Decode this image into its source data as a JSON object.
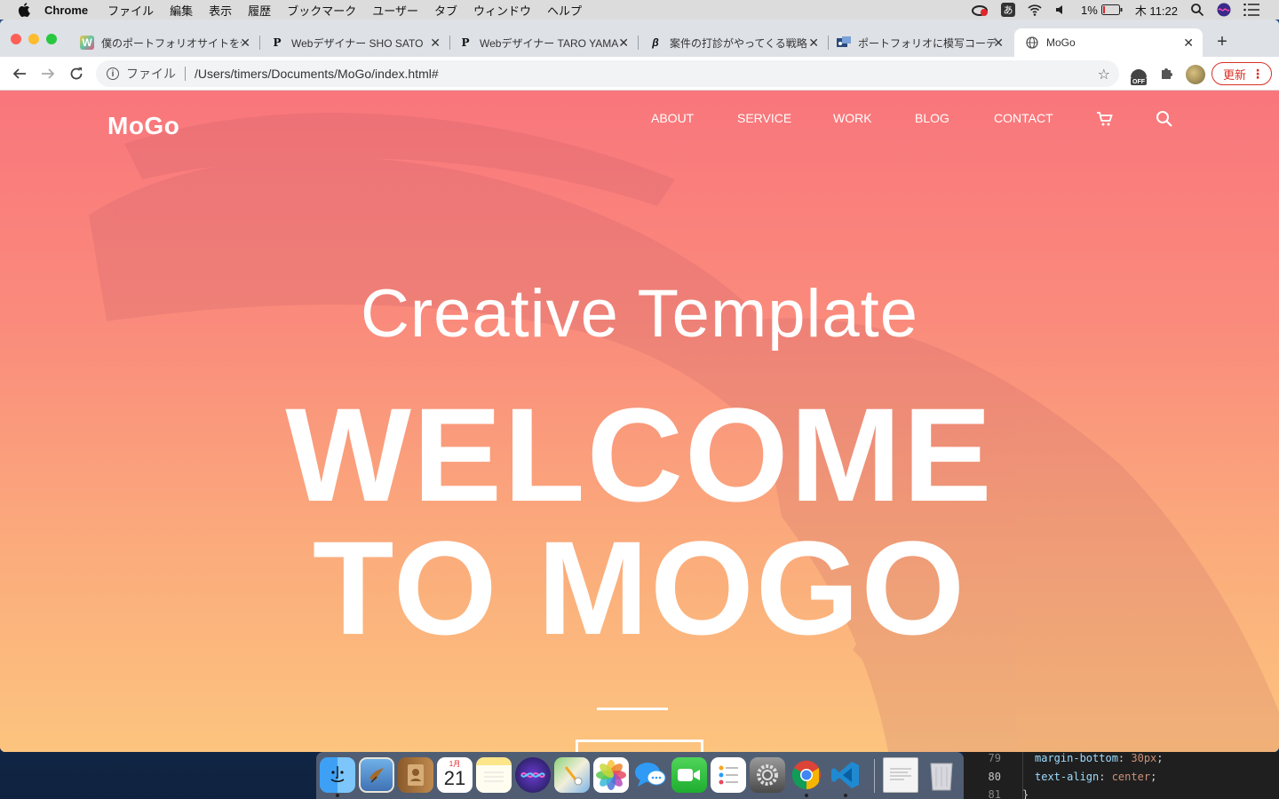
{
  "menubar": {
    "app_name": "Chrome",
    "items": [
      "ファイル",
      "編集",
      "表示",
      "履歴",
      "ブックマーク",
      "ユーザー",
      "タブ",
      "ウィンドウ",
      "ヘルプ"
    ],
    "battery": "1%",
    "clock": "木 11:22",
    "ime": "あ"
  },
  "browser": {
    "tabs": [
      {
        "title": "僕のポートフォリオサイトを公",
        "favicon": "W"
      },
      {
        "title": "Webデザイナー SHO SATO",
        "favicon": "P"
      },
      {
        "title": "Webデザイナー TARO YAMA",
        "favicon": "P"
      },
      {
        "title": "案件の打診がやってくる戦略",
        "favicon": "β"
      },
      {
        "title": "ポートフォリオに模写コーデ",
        "favicon": "img"
      },
      {
        "title": "MoGo",
        "favicon": "globe",
        "active": true
      }
    ],
    "address": {
      "scheme_label": "ファイル",
      "url": "/Users/timers/Documents/MoGo/index.html#"
    },
    "update_label": "更新",
    "ext_badge": "OFF"
  },
  "site": {
    "logo": "MoGo",
    "nav": [
      "ABOUT",
      "SERVICE",
      "WORK",
      "BLOG",
      "CONTACT"
    ],
    "hero_subtitle": "Creative Template",
    "hero_title_line1": "WELCOME",
    "hero_title_line2": "TO MOGO",
    "colors": {
      "gradient_top": "#f9767c",
      "gradient_bottom": "#fcc47e",
      "text": "#ffffff"
    }
  },
  "dock": {
    "calendar_month": "1月",
    "calendar_day": "21",
    "apps": [
      "finder",
      "mail",
      "contacts",
      "calendar",
      "notes",
      "siri",
      "maps",
      "photos",
      "messages",
      "facetime",
      "reminders",
      "system-preferences",
      "chrome",
      "vscode",
      "document",
      "trash"
    ]
  },
  "editor": {
    "lines": [
      {
        "num": "79",
        "prop": "margin-bottom",
        "value": "30px"
      },
      {
        "num": "80",
        "prop": "text-align",
        "value": "center"
      },
      {
        "num": "81",
        "prop": "",
        "value": ""
      }
    ],
    "closing_brace": "}"
  }
}
